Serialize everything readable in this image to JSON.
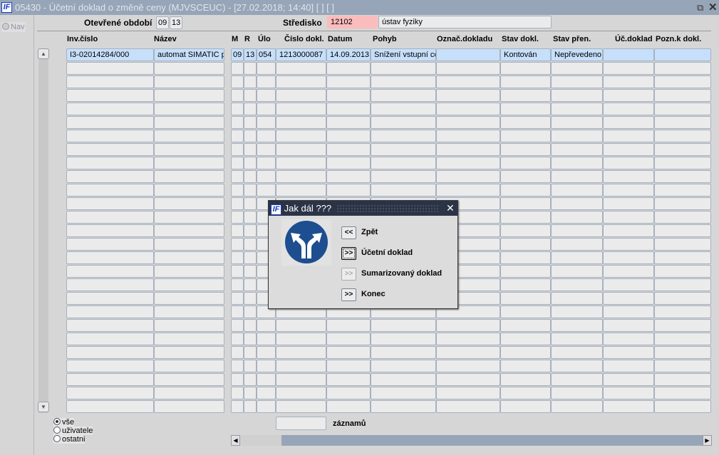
{
  "window": {
    "title": "05430 - Účetní doklad o změně ceny (MJVSCEUC) - [27.02.2018; 14:40]  [ ]  [ ]",
    "logo": "IF",
    "restore_icon": "restore-icon",
    "close_icon": "close-icon"
  },
  "nav": {
    "label": "Nav"
  },
  "header": {
    "period_label": "Otevřené období",
    "period_month": "09",
    "period_year": "13",
    "center_label": "Středisko",
    "center_code": "12102",
    "center_name": "ústav fyziky"
  },
  "columns": [
    "Inv.číslo",
    "Název",
    "M",
    "R",
    "Úlo",
    "Číslo dokl.",
    "Datum",
    "Pohyb",
    "Označ.dokladu",
    "Stav dokl.",
    "Stav přen.",
    "Úč.doklad",
    "Pozn.k dokl."
  ],
  "rows": [
    [
      "I3-02014284/000",
      "automat SIMATIC pr",
      "09",
      "13",
      "054",
      "1213000087",
      "14.09.2013",
      "Snížení vstupní ce",
      "",
      "Kontován",
      "Nepřevedeno",
      "",
      ""
    ]
  ],
  "empty_rows": 26,
  "filter": {
    "options": [
      "vše",
      "uživatele",
      "ostatni"
    ],
    "selected": "vše"
  },
  "records": {
    "label": "záznamů",
    "value": ""
  },
  "dialog": {
    "title": "Jak dál ???",
    "logo": "IF",
    "icon": "fork-arrow-sign-icon",
    "buttons": [
      {
        "glyph": "<<",
        "label": "Zpět",
        "enabled": true
      },
      {
        "glyph": ">>",
        "label": "Účetní doklad",
        "enabled": true,
        "focused": true
      },
      {
        "glyph": ">>",
        "label": "Sumarizovaný doklad",
        "enabled": false
      },
      {
        "glyph": ">>",
        "label": "Konec",
        "enabled": true
      }
    ]
  }
}
